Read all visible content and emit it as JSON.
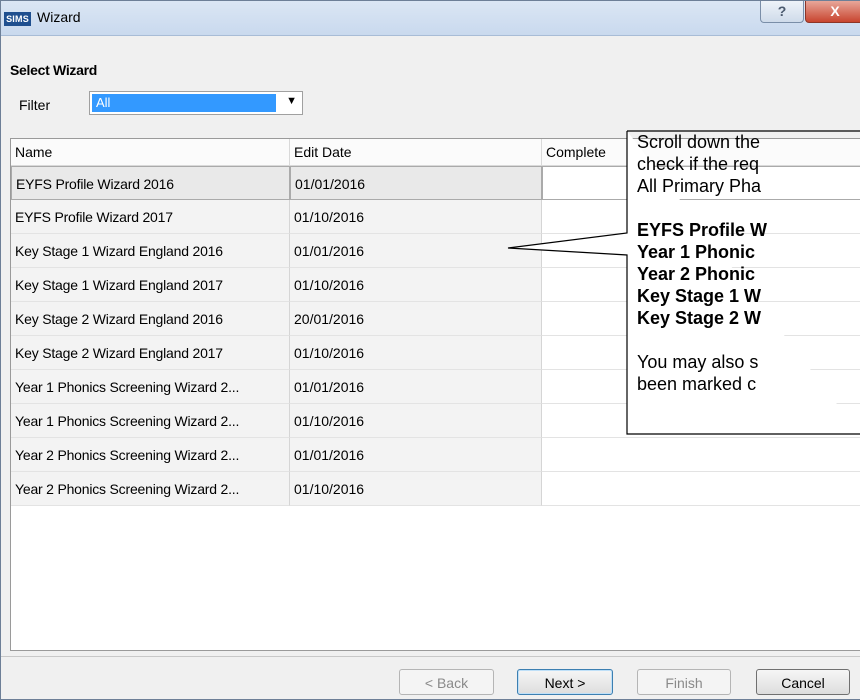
{
  "window": {
    "title": "Wizard",
    "logo_text": "SIMS",
    "help_label": "?",
    "close_label": "X"
  },
  "heading": "Select Wizard",
  "filter": {
    "label": "Filter",
    "selected": "All",
    "arrow": "▼"
  },
  "grid": {
    "columns": [
      "Name",
      "Edit Date",
      "Complete"
    ],
    "rows": [
      {
        "name": "EYFS Profile Wizard 2016",
        "edit_date": "01/01/2016",
        "complete": ""
      },
      {
        "name": "EYFS Profile Wizard 2017",
        "edit_date": "01/10/2016",
        "complete": ""
      },
      {
        "name": "Key Stage 1 Wizard England 2016",
        "edit_date": "01/01/2016",
        "complete": ""
      },
      {
        "name": "Key Stage 1 Wizard England 2017",
        "edit_date": "01/10/2016",
        "complete": ""
      },
      {
        "name": "Key Stage 2 Wizard England 2016",
        "edit_date": "20/01/2016",
        "complete": ""
      },
      {
        "name": "Key Stage 2 Wizard England 2017",
        "edit_date": "01/10/2016",
        "complete": ""
      },
      {
        "name": "Year 1 Phonics Screening Wizard 2...",
        "edit_date": "01/01/2016",
        "complete": ""
      },
      {
        "name": "Year 1 Phonics Screening Wizard 2...",
        "edit_date": "01/10/2016",
        "complete": ""
      },
      {
        "name": "Year 2 Phonics Screening Wizard 2...",
        "edit_date": "01/01/2016",
        "complete": ""
      },
      {
        "name": "Year 2 Phonics Screening Wizard 2...",
        "edit_date": "01/10/2016",
        "complete": ""
      }
    ]
  },
  "buttons": {
    "back": "< Back",
    "next": "Next >",
    "finish": "Finish",
    "cancel": "Cancel"
  },
  "callout": {
    "intro_lines": [
      "Scroll down the",
      "check if the req",
      "All Primary Pha"
    ],
    "bold_lines": [
      "EYFS Profile W",
      "Year 1 Phonic",
      "Year 2 Phonic",
      "Key Stage 1 W",
      "Key Stage 2 W"
    ],
    "outro_lines": [
      "You may also s",
      "been marked c"
    ]
  },
  "colors": {
    "selection": "#3399ff",
    "close": "#c8452f",
    "titlebar": "#dbe6f4"
  }
}
